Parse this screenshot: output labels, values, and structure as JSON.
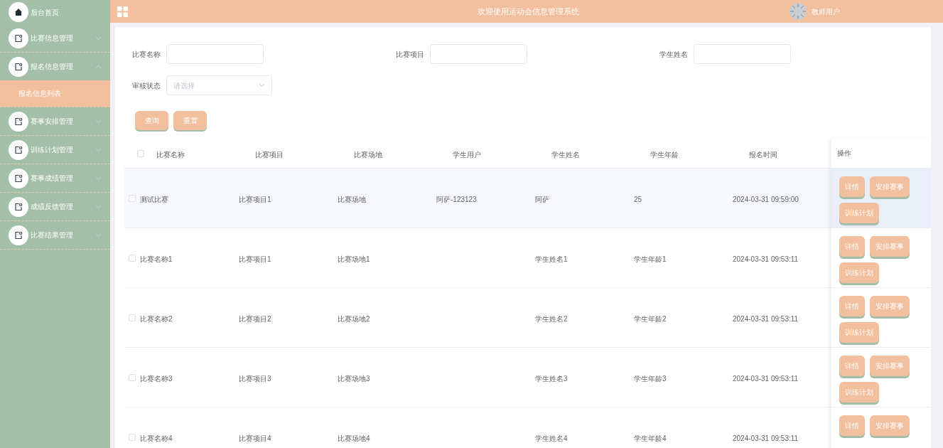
{
  "sidebar": {
    "items": [
      {
        "kind": "home",
        "label": "后台首页"
      },
      {
        "kind": "group",
        "label": "比赛信息管理",
        "expanded": false
      },
      {
        "kind": "group",
        "label": "报名信息管理",
        "expanded": true,
        "children": [
          {
            "label": "报名信息列表",
            "selected": true
          }
        ]
      },
      {
        "kind": "group",
        "label": "赛事安排管理",
        "expanded": false
      },
      {
        "kind": "group",
        "label": "训练计划管理",
        "expanded": false
      },
      {
        "kind": "group",
        "label": "赛事成绩管理",
        "expanded": false
      },
      {
        "kind": "group",
        "label": "成绩反馈管理",
        "expanded": false
      },
      {
        "kind": "group",
        "label": "比赛结果管理",
        "expanded": false
      }
    ]
  },
  "header": {
    "title": "欢迎使用运动会信息管理系统",
    "user": "教师用户"
  },
  "filters": [
    {
      "kind": "input",
      "label": "比赛名称"
    },
    {
      "kind": "input",
      "label": "比赛项目"
    },
    {
      "kind": "input",
      "label": "学生姓名"
    },
    {
      "kind": "select",
      "label": "审核状态",
      "placeholder": "请选择"
    }
  ],
  "filter_buttons": [
    "查询",
    "重置"
  ],
  "table": {
    "select_all": {
      "checked": false
    },
    "columns": [
      "比赛名称",
      "比赛项目",
      "比赛场地",
      "学生用户",
      "学生姓名",
      "学生年龄",
      "报名时间"
    ],
    "action_column": "操作",
    "rows": [
      {
        "checked": false,
        "hovered": true,
        "cells": [
          "测试比赛",
          "比赛项目1",
          "比赛场地",
          "阿萨-123123",
          "阿萨",
          "25",
          "2024-03-31 09:59:00"
        ],
        "actions": [
          "详情",
          "安排赛事",
          "训练计划"
        ]
      },
      {
        "checked": false,
        "hovered": false,
        "cells": [
          "比赛名称1",
          "比赛项目1",
          "比赛场地1",
          "",
          "学生姓名1",
          "学生年龄1",
          "2024-03-31 09:53:11"
        ],
        "actions": [
          "详情",
          "安排赛事",
          "训练计划"
        ]
      },
      {
        "checked": false,
        "hovered": false,
        "cells": [
          "比赛名称2",
          "比赛项目2",
          "比赛场地2",
          "",
          "学生姓名2",
          "学生年龄2",
          "2024-03-31 09:53:11"
        ],
        "actions": [
          "详情",
          "安排赛事",
          "训练计划"
        ]
      },
      {
        "checked": false,
        "hovered": false,
        "cells": [
          "比赛名称3",
          "比赛项目3",
          "比赛场地3",
          "",
          "学生姓名3",
          "学生年龄3",
          "2024-03-31 09:53:11"
        ],
        "actions": [
          "详情",
          "安排赛事",
          "训练计划"
        ]
      },
      {
        "checked": false,
        "hovered": false,
        "cells": [
          "比赛名称4",
          "比赛项目4",
          "比赛场地4",
          "",
          "学生姓名4",
          "学生年龄4",
          "2024-03-31 09:53:11"
        ],
        "actions": [
          "详情",
          "安排赛事"
        ]
      }
    ]
  }
}
